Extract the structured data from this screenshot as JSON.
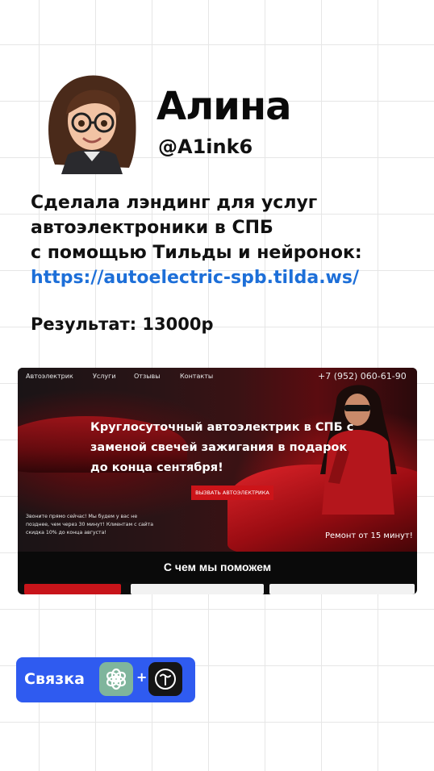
{
  "profile": {
    "name": "Алина",
    "handle": "@A1ink6"
  },
  "description": {
    "line1": "Сделала лэндинг для услуг",
    "line2": "автоэлектроники в СПБ",
    "line3": "с помощью Тильды и нейронок:",
    "link": "https://autoelectric-spb.tilda.ws/"
  },
  "result": "Результат: 13000р",
  "landing": {
    "nav": {
      "brand": "Автоэлектрик",
      "services": "Услуги",
      "reviews": "Отзывы",
      "contacts": "Контакты",
      "phone": "+7 (952) 060-61-90"
    },
    "hero": {
      "title_line1": "Круглосуточный автоэлектрик в СПБ с",
      "title_line2": "заменой свечей зажигания в подарок",
      "title_line3": "до конца сентября!",
      "cta": "ВЫЗВАТЬ АВТОЭЛЕКТРИКА",
      "call_line1": "Звоните прямо сейчас! Мы будем у вас не",
      "call_line2": "позднее, чем через 30 минут! Клиентам с сайта",
      "call_line3": "скидка 10% до конца августа!",
      "repair": "Ремонт от 15 минут!"
    },
    "help_title": "С чем мы поможем"
  },
  "tools": {
    "label": "Связка",
    "plus": "+",
    "icons": [
      "chatgpt-icon",
      "tilda-icon"
    ]
  },
  "colors": {
    "accent_blue": "#2f5bf0",
    "link_blue": "#1d6fd8",
    "cta_red": "#cc1419",
    "chatgpt_green": "#7fb59c"
  }
}
